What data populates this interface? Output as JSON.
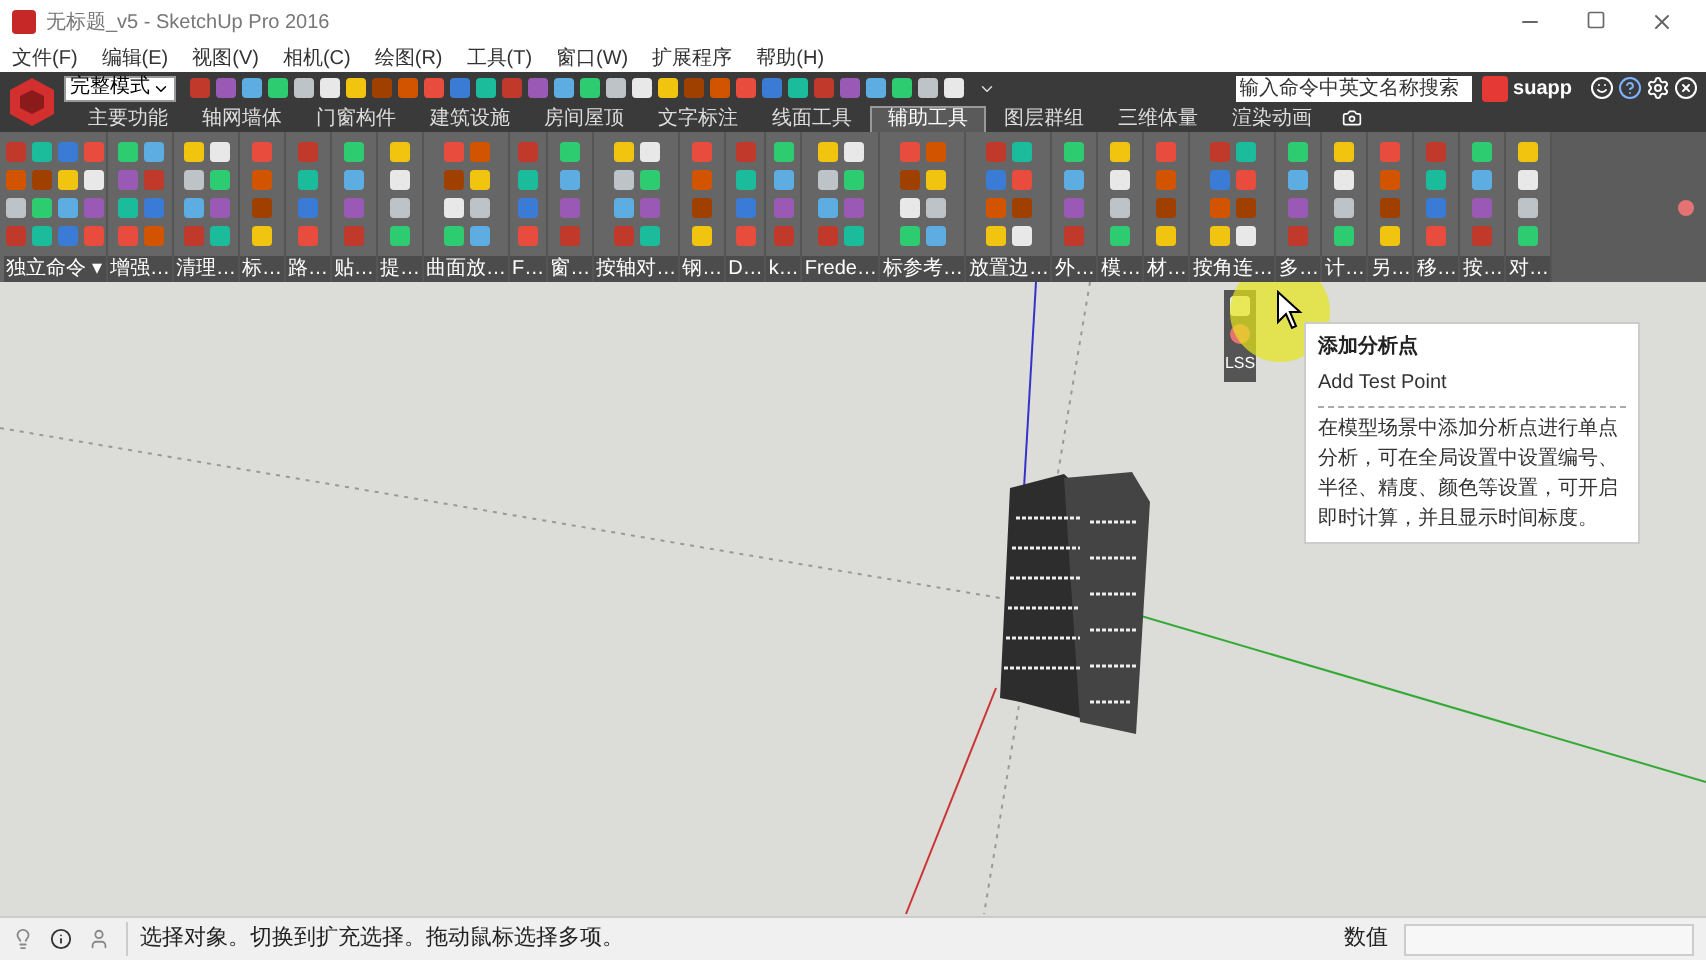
{
  "window": {
    "title": "无标题_v5 - SketchUp Pro 2016"
  },
  "menu": [
    "文件(F)",
    "编辑(E)",
    "视图(V)",
    "相机(C)",
    "绘图(R)",
    "工具(T)",
    "窗口(W)",
    "扩展程序",
    "帮助(H)"
  ],
  "toolbar": {
    "mode_select": "完整模式",
    "search": {
      "placeholder": "输入命令中英文名称搜索"
    },
    "brand": "suapp"
  },
  "tabs": [
    {
      "label": "主要功能",
      "selected": false
    },
    {
      "label": "轴网墙体",
      "selected": false
    },
    {
      "label": "门窗构件",
      "selected": false
    },
    {
      "label": "建筑设施",
      "selected": false
    },
    {
      "label": "房间屋顶",
      "selected": false
    },
    {
      "label": "文字标注",
      "selected": false
    },
    {
      "label": "线面工具",
      "selected": false
    },
    {
      "label": "辅助工具",
      "selected": true
    },
    {
      "label": "图层群组",
      "selected": false
    },
    {
      "label": "三维体量",
      "selected": false
    },
    {
      "label": "渲染动画",
      "selected": false
    }
  ],
  "tool_groups": [
    "独立命令 ▾",
    "增强…",
    "清理…",
    "标…",
    "路…",
    "贴…",
    "提…",
    "曲面放…",
    "F…",
    "窗…",
    "按轴对…",
    "钢…",
    "D…",
    "k…",
    "Frede…",
    "标参考…",
    "放置边…",
    "外…",
    "模…",
    "材…",
    "按角连…",
    "多…",
    "计…",
    "另…",
    "移…",
    "按…",
    "对…"
  ],
  "floating_toolbar": {
    "label": "LSS"
  },
  "tooltip": {
    "title": "添加分析点",
    "subtitle": "Add Test Point",
    "body": "在模型场景中添加分析点进行单点分析，可在全局设置中设置编号、半径、精度、颜色等设置，可开启即时计算，并且显示时间标度。"
  },
  "status_bar": {
    "message": "选择对象。切换到扩充选择。拖动鼠标选择多项。",
    "value_label": "数值"
  }
}
